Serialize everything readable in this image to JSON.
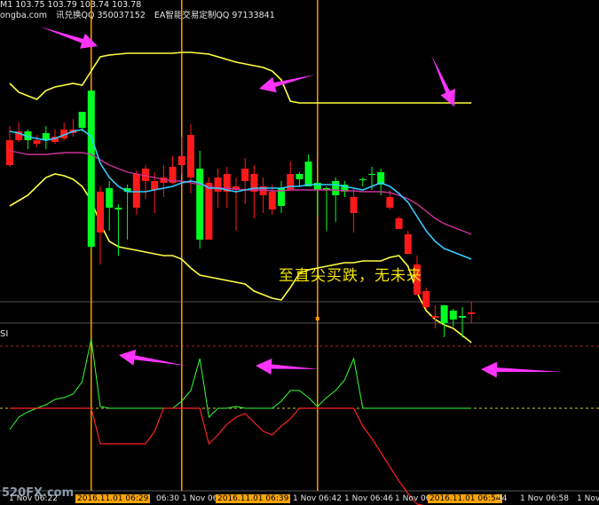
{
  "header": {
    "symbol_line": "M1  103.75 103.79 103.74 103.78",
    "site": "ongba.com",
    "qq1": "讯兑换QQ 350037152",
    "qq2": "EA智能交易定制QQ 97133841"
  },
  "annotation": "至直尖买跌，无未来",
  "subwindow_label": "SI",
  "watermark": "520FX.com",
  "colors": {
    "background": "#000000",
    "bull": "#00ff22",
    "bear": "#ff1a1a",
    "band": "#ffff40",
    "ma_fast": "#33ccff",
    "ma_slow": "#cc3399",
    "arrow": "#ff33ff",
    "marker": "#ff9900",
    "indicator_up": "#33ff33",
    "indicator_down": "#ff2222"
  },
  "x_ticks": [
    {
      "label": "1 Nov 06:22",
      "hl": false
    },
    {
      "label": "2016.11.01 06:29",
      "hl": true
    },
    {
      "label": "06:30",
      "hl": false
    },
    {
      "label": "1 Nov 06:3",
      "hl": false
    },
    {
      "label": "2016.11.01 06:39",
      "hl": true
    },
    {
      "label": "1 Nov 06:42",
      "hl": false
    },
    {
      "label": "1 Nov 06:46",
      "hl": false
    },
    {
      "label": "1 Nov 06:50",
      "hl": false
    },
    {
      "label": "2016.11.01 06:54",
      "hl": true
    },
    {
      "label": "54",
      "hl": false
    },
    {
      "label": "1 Nov 06:58",
      "hl": false
    },
    {
      "label": "1 Nov",
      "hl": false
    }
  ],
  "chart_data": {
    "type": "candlestick",
    "candles": [
      {
        "o": 2,
        "h": 18,
        "l": -28,
        "c": -26
      },
      {
        "o": 12,
        "h": 22,
        "l": 0,
        "c": 2
      },
      {
        "o": 2,
        "h": 14,
        "l": -8,
        "c": 12
      },
      {
        "o": 2,
        "h": 8,
        "l": -6,
        "c": -2
      },
      {
        "o": 2,
        "h": 18,
        "l": -8,
        "c": 10
      },
      {
        "o": 6,
        "h": 14,
        "l": -2,
        "c": 0
      },
      {
        "o": 14,
        "h": 22,
        "l": 2,
        "c": 4
      },
      {
        "o": 14,
        "h": 26,
        "l": 6,
        "c": 10
      },
      {
        "o": 16,
        "h": 34,
        "l": 12,
        "c": 34
      },
      {
        "o": -118,
        "h": 58,
        "l": -120,
        "c": 58
      },
      {
        "o": -56,
        "h": -50,
        "l": -138,
        "c": -102
      },
      {
        "o": -74,
        "h": -44,
        "l": -100,
        "c": -52
      },
      {
        "o": -76,
        "h": -70,
        "l": -128,
        "c": -74
      },
      {
        "o": -56,
        "h": -48,
        "l": -110,
        "c": -52
      },
      {
        "o": -36,
        "h": -32,
        "l": -82,
        "c": -74
      },
      {
        "o": -30,
        "h": -26,
        "l": -64,
        "c": -44
      },
      {
        "o": -44,
        "h": -34,
        "l": -80,
        "c": -54
      },
      {
        "o": -40,
        "h": -26,
        "l": -62,
        "c": -46
      },
      {
        "o": -28,
        "h": -16,
        "l": -48,
        "c": -46
      },
      {
        "o": -16,
        "h": 6,
        "l": -36,
        "c": -26
      },
      {
        "o": 8,
        "h": 20,
        "l": -58,
        "c": -40
      },
      {
        "o": -110,
        "h": -10,
        "l": -120,
        "c": -30
      },
      {
        "o": -46,
        "h": -40,
        "l": -110,
        "c": -110
      },
      {
        "o": -40,
        "h": -30,
        "l": -74,
        "c": -56
      },
      {
        "o": -36,
        "h": -28,
        "l": -74,
        "c": -56
      },
      {
        "o": -50,
        "h": -40,
        "l": -100,
        "c": -54
      },
      {
        "o": -30,
        "h": -18,
        "l": -70,
        "c": -44
      },
      {
        "o": -36,
        "h": -26,
        "l": -86,
        "c": -56
      },
      {
        "o": -50,
        "h": -40,
        "l": -80,
        "c": -60
      },
      {
        "o": -56,
        "h": -48,
        "l": -82,
        "c": -76
      },
      {
        "o": -72,
        "h": -44,
        "l": -80,
        "c": -52
      },
      {
        "o": -36,
        "h": -22,
        "l": -54,
        "c": -54
      },
      {
        "o": -42,
        "h": -34,
        "l": -50,
        "c": -36
      },
      {
        "o": -50,
        "h": -14,
        "l": -50,
        "c": -22
      },
      {
        "o": -54,
        "h": -44,
        "l": -84,
        "c": -46
      },
      {
        "o": -54,
        "h": -50,
        "l": -100,
        "c": -52
      },
      {
        "o": -60,
        "h": -40,
        "l": -90,
        "c": -44
      },
      {
        "o": -56,
        "h": -44,
        "l": -62,
        "c": -48
      },
      {
        "o": -62,
        "h": -52,
        "l": -102,
        "c": -80
      },
      {
        "o": -42,
        "h": -40,
        "l": -50,
        "c": -42
      },
      {
        "o": -36,
        "h": -28,
        "l": -54,
        "c": -36
      },
      {
        "o": -48,
        "h": -30,
        "l": -60,
        "c": -34
      },
      {
        "o": -62,
        "h": -54,
        "l": -76,
        "c": -74
      },
      {
        "o": -86,
        "h": -84,
        "l": -98,
        "c": -98
      },
      {
        "o": -104,
        "h": -100,
        "l": -126,
        "c": -126
      },
      {
        "o": -138,
        "h": -128,
        "l": -166,
        "c": -172
      },
      {
        "o": -168,
        "h": -164,
        "l": -188,
        "c": -186
      },
      {
        "o": -196,
        "h": -184,
        "l": -210,
        "c": -198
      },
      {
        "o": -204,
        "h": -184,
        "l": -220,
        "c": -184
      },
      {
        "o": -200,
        "h": -188,
        "l": -208,
        "c": -190
      },
      {
        "o": -198,
        "h": -186,
        "l": -220,
        "c": -196
      },
      {
        "o": -192,
        "h": -180,
        "l": -204,
        "c": -194
      }
    ],
    "upper_band": [
      66,
      56,
      52,
      48,
      58,
      62,
      64,
      66,
      64,
      80,
      96,
      98,
      99,
      100,
      100,
      100,
      100,
      100,
      100,
      101,
      101,
      100,
      99,
      96,
      93,
      90,
      88,
      86,
      84,
      80,
      70,
      46,
      44,
      44,
      44,
      44,
      44,
      44,
      44,
      44,
      44,
      44,
      44,
      44,
      44,
      44,
      44,
      44,
      44,
      44,
      44,
      44
    ],
    "lower_band": [
      -72,
      -66,
      -60,
      -50,
      -40,
      -36,
      -38,
      -42,
      -50,
      -66,
      -92,
      -112,
      -118,
      -120,
      -122,
      -124,
      -126,
      -128,
      -128,
      -132,
      -142,
      -150,
      -152,
      -154,
      -156,
      -158,
      -160,
      -168,
      -172,
      -176,
      -178,
      -164,
      -148,
      -144,
      -142,
      -140,
      -138,
      -136,
      -136,
      -134,
      -134,
      -134,
      -130,
      -128,
      -140,
      -170,
      -190,
      -200,
      -206,
      -210,
      -218,
      -226
    ],
    "ma_fast": [
      12,
      10,
      6,
      4,
      2,
      4,
      8,
      12,
      14,
      6,
      -24,
      -40,
      -50,
      -56,
      -56,
      -56,
      -54,
      -52,
      -50,
      -46,
      -44,
      -46,
      -52,
      -52,
      -54,
      -56,
      -54,
      -52,
      -52,
      -52,
      -52,
      -50,
      -50,
      -48,
      -48,
      -48,
      -48,
      -50,
      -52,
      -54,
      -50,
      -46,
      -50,
      -58,
      -68,
      -84,
      -100,
      -112,
      -120,
      -124,
      -128,
      -132
    ],
    "ma_slow": [
      -10,
      -12,
      -14,
      -14,
      -14,
      -13,
      -12,
      -12,
      -12,
      -14,
      -20,
      -26,
      -30,
      -34,
      -36,
      -38,
      -40,
      -42,
      -44,
      -44,
      -46,
      -48,
      -50,
      -52,
      -52,
      -53,
      -54,
      -54,
      -54,
      -55,
      -55,
      -54,
      -54,
      -54,
      -54,
      -54,
      -54,
      -55,
      -55,
      -56,
      -56,
      -56,
      -57,
      -60,
      -64,
      -70,
      -78,
      -86,
      -92,
      -96,
      -100,
      -104
    ],
    "indicator": {
      "line_up": [
        16,
        30,
        36,
        40,
        44,
        50,
        52,
        56,
        70,
        118,
        42,
        40,
        40,
        40,
        40,
        40,
        40,
        40,
        40,
        48,
        60,
        96,
        30,
        40,
        40,
        42,
        40,
        40,
        40,
        40,
        48,
        60,
        60,
        52,
        42,
        52,
        60,
        72,
        96,
        40,
        40,
        40,
        40,
        40,
        40,
        40,
        40,
        40,
        40,
        40,
        40,
        40
      ],
      "line_down": [
        40,
        40,
        40,
        40,
        40,
        40,
        40,
        40,
        40,
        40,
        0,
        0,
        0,
        0,
        0,
        0,
        14,
        40,
        40,
        40,
        40,
        40,
        0,
        10,
        22,
        30,
        34,
        24,
        14,
        10,
        20,
        28,
        40,
        40,
        40,
        40,
        40,
        40,
        40,
        20,
        6,
        -10,
        -26,
        -42,
        -56,
        -68,
        -70,
        -70,
        -70,
        -70,
        -70,
        -70
      ],
      "zero_level": 40,
      "upper_level": 110
    },
    "signals": [
      {
        "candle": 9,
        "label": "2016.11.01 06:29"
      },
      {
        "candle": 19,
        "label": "2016.11.01 06:39"
      },
      {
        "candle": 34,
        "label": "2016.11.01 06:54"
      }
    ]
  }
}
